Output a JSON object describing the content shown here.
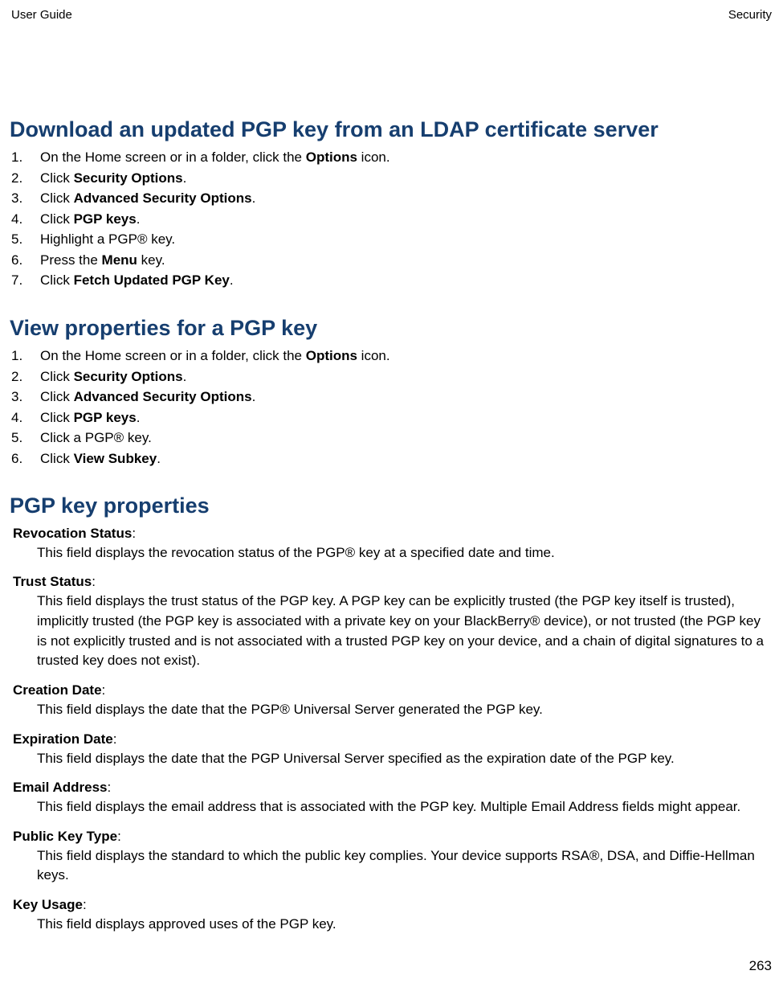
{
  "header": {
    "left": "User Guide",
    "right": "Security"
  },
  "section1": {
    "heading": "Download an updated PGP key from an LDAP certificate server",
    "steps": [
      {
        "pre": "On the Home screen or in a folder, click the ",
        "bold": "Options",
        "post": " icon."
      },
      {
        "pre": "Click ",
        "bold": "Security Options",
        "post": "."
      },
      {
        "pre": "Click ",
        "bold": "Advanced Security Options",
        "post": "."
      },
      {
        "pre": "Click ",
        "bold": "PGP keys",
        "post": "."
      },
      {
        "pre": "Highlight a PGP® key.",
        "bold": "",
        "post": ""
      },
      {
        "pre": "Press the ",
        "bold": "Menu",
        "post": " key."
      },
      {
        "pre": "Click ",
        "bold": "Fetch Updated PGP Key",
        "post": "."
      }
    ]
  },
  "section2": {
    "heading": "View properties for a PGP key",
    "steps": [
      {
        "pre": "On the Home screen or in a folder, click the ",
        "bold": "Options",
        "post": " icon."
      },
      {
        "pre": "Click ",
        "bold": "Security Options",
        "post": "."
      },
      {
        "pre": "Click ",
        "bold": "Advanced Security Options",
        "post": "."
      },
      {
        "pre": "Click ",
        "bold": "PGP keys",
        "post": "."
      },
      {
        "pre": "Click a PGP® key.",
        "bold": "",
        "post": ""
      },
      {
        "pre": "Click ",
        "bold": "View Subkey",
        "post": "."
      }
    ]
  },
  "section3": {
    "heading": "PGP key properties",
    "properties": [
      {
        "term": "Revocation Status",
        "desc": "This field displays the revocation status of the PGP® key at a specified date and time."
      },
      {
        "term": "Trust Status",
        "desc": "This field displays the trust status of the PGP key. A PGP key can be explicitly trusted (the PGP key itself is trusted), implicitly trusted (the PGP key is associated with a private key on your BlackBerry® device), or not trusted (the PGP key is not explicitly trusted and is not associated with a trusted PGP key on your device, and a chain of digital signatures to a trusted key does not exist)."
      },
      {
        "term": "Creation Date",
        "desc": "This field displays the date that the PGP® Universal Server generated the PGP key."
      },
      {
        "term": "Expiration Date",
        "desc": "This field displays the date that the PGP Universal Server specified as the expiration date of the PGP key."
      },
      {
        "term": "Email Address",
        "desc": "This field displays the email address that is associated with the PGP key. Multiple Email Address fields might appear."
      },
      {
        "term": "Public Key Type",
        "desc": "This field displays the standard to which the public key complies. Your device supports RSA®, DSA, and Diffie-Hellman keys."
      },
      {
        "term": "Key Usage",
        "desc": "This field displays approved uses of the PGP key."
      }
    ]
  },
  "pageNumber": "263"
}
